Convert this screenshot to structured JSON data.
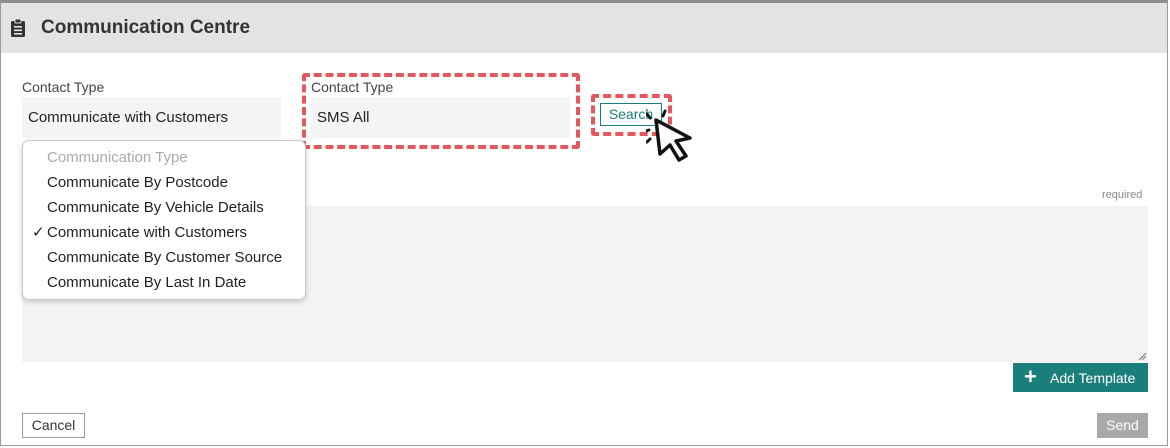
{
  "header": {
    "title": "Communication Centre",
    "icon": "clipboard-icon"
  },
  "form": {
    "contact_type_label_1": "Contact Type",
    "contact_type_value_1": "Communicate with Customers",
    "contact_type_label_2": "Contact Type",
    "contact_type_value_2": "SMS All",
    "search_label": "Search",
    "required_label": "required"
  },
  "dropdown": {
    "items": [
      {
        "label": "Communication Type",
        "disabled": true,
        "checked": false
      },
      {
        "label": "Communicate By Postcode",
        "disabled": false,
        "checked": false
      },
      {
        "label": "Communicate By Vehicle Details",
        "disabled": false,
        "checked": false
      },
      {
        "label": "Communicate with Customers",
        "disabled": false,
        "checked": true
      },
      {
        "label": "Communicate By Customer Source",
        "disabled": false,
        "checked": false
      },
      {
        "label": "Communicate By Last In Date",
        "disabled": false,
        "checked": false
      }
    ],
    "check_glyph": "✓"
  },
  "actions": {
    "add_template_label": "Add Template",
    "add_template_icon": "plus-icon",
    "cancel_label": "Cancel",
    "send_label": "Send"
  },
  "colors": {
    "accent": "#1a7f7a",
    "highlight": "#e4585d",
    "header_bg": "#e3e3e3",
    "send_disabled": "#a9a9a9"
  }
}
